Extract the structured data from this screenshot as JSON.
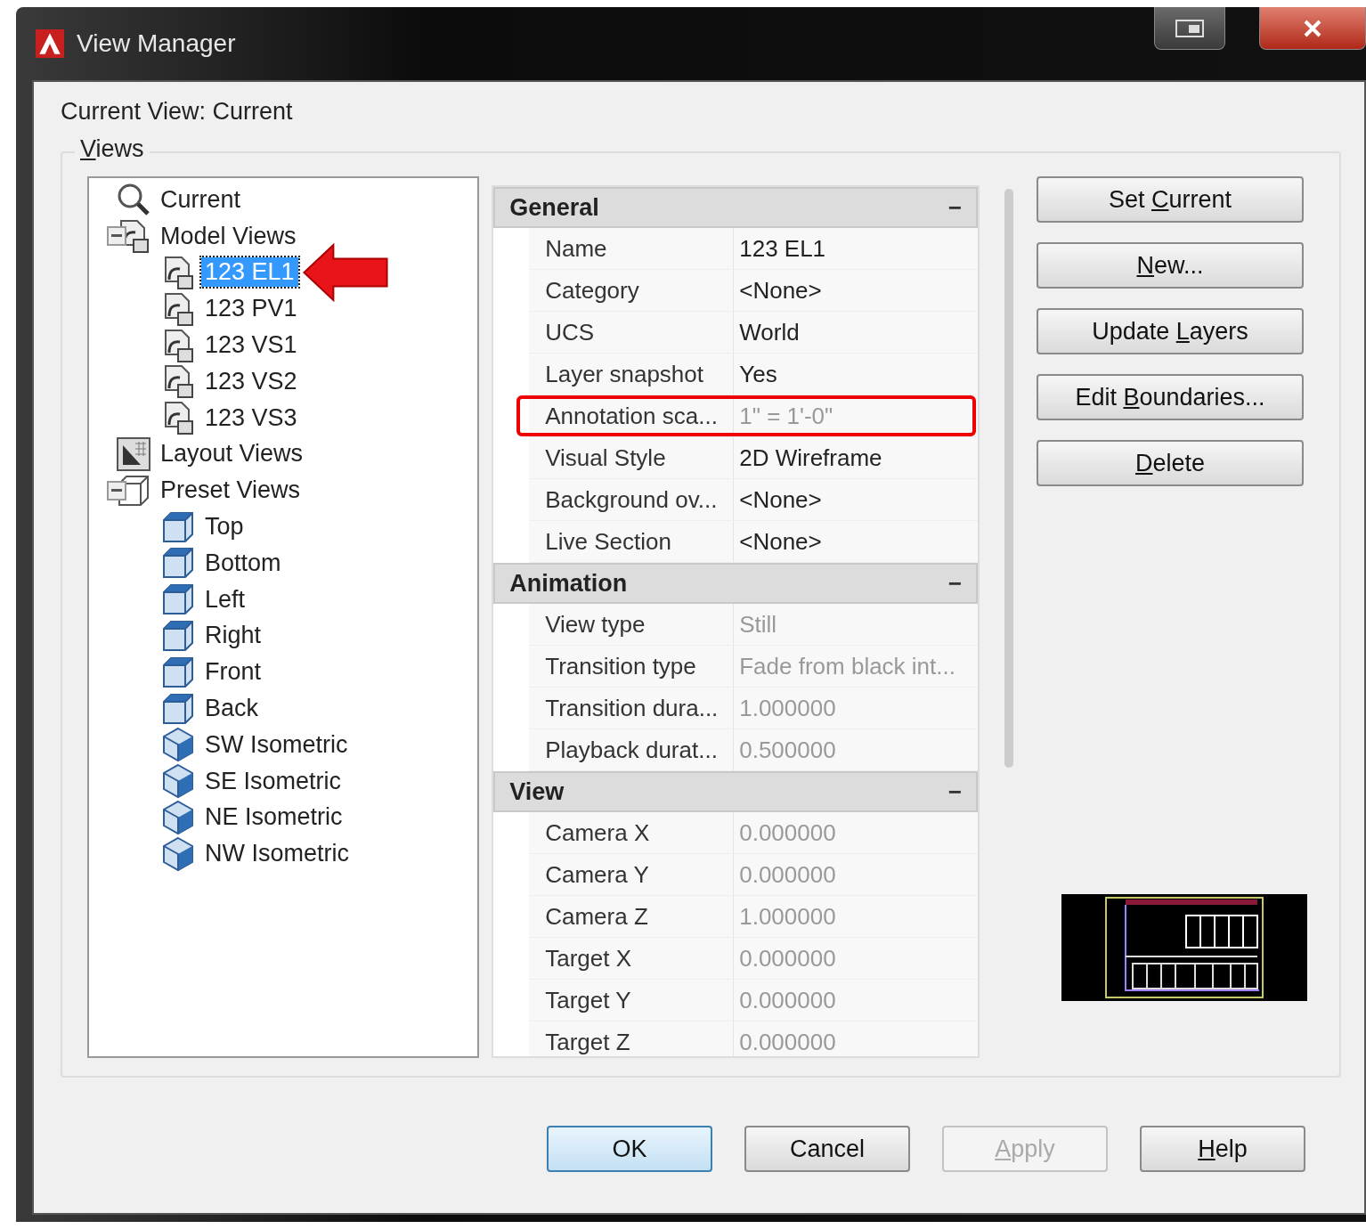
{
  "window": {
    "title": "View Manager"
  },
  "current_view": "Current View: Current",
  "views_group": {
    "label": [
      {
        "text": "V",
        "underlined": true
      },
      {
        "text": "iews",
        "underlined": false
      }
    ]
  },
  "tree": [
    {
      "label": "Current",
      "kind": "magnifier",
      "selected": false
    },
    {
      "label": "Model Views",
      "kind": "view",
      "selected": false,
      "expanded": true,
      "children": [
        {
          "label": "123 EL1",
          "kind": "view",
          "selected": true,
          "pointed": true
        },
        {
          "label": "123 PV1",
          "kind": "view",
          "selected": false
        },
        {
          "label": "123 VS1",
          "kind": "view",
          "selected": false
        },
        {
          "label": "123 VS2",
          "kind": "view",
          "selected": false
        },
        {
          "label": "123 VS3",
          "kind": "view",
          "selected": false
        }
      ]
    },
    {
      "label": "Layout Views",
      "kind": "layout",
      "selected": false
    },
    {
      "label": "Preset Views",
      "kind": "box",
      "selected": false,
      "expanded": true,
      "children": [
        {
          "label": "Top",
          "kind": "cube",
          "selected": false
        },
        {
          "label": "Bottom",
          "kind": "cube",
          "selected": false
        },
        {
          "label": "Left",
          "kind": "cube",
          "selected": false
        },
        {
          "label": "Right",
          "kind": "cube",
          "selected": false
        },
        {
          "label": "Front",
          "kind": "cube",
          "selected": false
        },
        {
          "label": "Back",
          "kind": "cube",
          "selected": false
        },
        {
          "label": "SW Isometric",
          "kind": "iso",
          "selected": false
        },
        {
          "label": "SE Isometric",
          "kind": "iso",
          "selected": false
        },
        {
          "label": "NE Isometric",
          "kind": "iso",
          "selected": false
        },
        {
          "label": "NW Isometric",
          "kind": "iso",
          "selected": false
        }
      ]
    }
  ],
  "sections": [
    {
      "title": "General",
      "toggle": "−",
      "rows": [
        {
          "name": "Name",
          "value": "123 EL1",
          "readonly": false,
          "highlighted": false
        },
        {
          "name": "Category",
          "value": "<None>",
          "readonly": false,
          "highlighted": false
        },
        {
          "name": "UCS",
          "value": "World",
          "readonly": false,
          "highlighted": false
        },
        {
          "name": "Layer snapshot",
          "value": "Yes",
          "readonly": false,
          "highlighted": false
        },
        {
          "name": "Annotation sca...",
          "value": "1\" = 1'-0\"",
          "readonly": true,
          "highlighted": true
        },
        {
          "name": "Visual Style",
          "value": "2D Wireframe",
          "readonly": false,
          "highlighted": false
        },
        {
          "name": "Background ov...",
          "value": "<None>",
          "readonly": false,
          "highlighted": false
        },
        {
          "name": "Live Section",
          "value": "<None>",
          "readonly": false,
          "highlighted": false
        }
      ]
    },
    {
      "title": "Animation",
      "toggle": "−",
      "rows": [
        {
          "name": "View type",
          "value": "Still",
          "readonly": true,
          "highlighted": false
        },
        {
          "name": "Transition type",
          "value": "Fade from black int...",
          "readonly": true,
          "highlighted": false
        },
        {
          "name": "Transition dura...",
          "value": "1.000000",
          "readonly": true,
          "highlighted": false
        },
        {
          "name": "Playback durat...",
          "value": "0.500000",
          "readonly": true,
          "highlighted": false
        }
      ]
    },
    {
      "title": "View",
      "toggle": "−",
      "rows": [
        {
          "name": "Camera X",
          "value": "0.000000",
          "readonly": true,
          "highlighted": false
        },
        {
          "name": "Camera Y",
          "value": "0.000000",
          "readonly": true,
          "highlighted": false
        },
        {
          "name": "Camera Z",
          "value": "1.000000",
          "readonly": true,
          "highlighted": false
        },
        {
          "name": "Target X",
          "value": "0.000000",
          "readonly": true,
          "highlighted": false
        },
        {
          "name": "Target Y",
          "value": "0.000000",
          "readonly": true,
          "highlighted": false
        },
        {
          "name": "Target Z",
          "value": "0.000000",
          "readonly": true,
          "highlighted": false
        }
      ]
    }
  ],
  "side_buttons": [
    {
      "label": [
        {
          "text": "Set ",
          "underlined": false
        },
        {
          "text": "C",
          "underlined": true
        },
        {
          "text": "urrent",
          "underlined": false
        }
      ],
      "disabled": false
    },
    {
      "label": [
        {
          "text": "N",
          "underlined": true
        },
        {
          "text": "ew...",
          "underlined": false
        }
      ],
      "disabled": false
    },
    {
      "label": [
        {
          "text": "Update ",
          "underlined": false
        },
        {
          "text": "L",
          "underlined": true
        },
        {
          "text": "ayers",
          "underlined": false
        }
      ],
      "disabled": false
    },
    {
      "label": [
        {
          "text": "Edit ",
          "underlined": false
        },
        {
          "text": "B",
          "underlined": true
        },
        {
          "text": "oundaries...",
          "underlined": false
        }
      ],
      "disabled": false
    },
    {
      "label": [
        {
          "text": "D",
          "underlined": true
        },
        {
          "text": "elete",
          "underlined": false
        }
      ],
      "disabled": false
    }
  ],
  "footer_buttons": [
    {
      "label": [
        {
          "text": "OK",
          "underlined": false
        }
      ],
      "disabled": false,
      "default": true
    },
    {
      "label": [
        {
          "text": "Cancel",
          "underlined": false
        }
      ],
      "disabled": false,
      "default": false
    },
    {
      "label": [
        {
          "text": "A",
          "underlined": true
        },
        {
          "text": "pply",
          "underlined": false
        }
      ],
      "disabled": true,
      "default": false
    },
    {
      "label": [
        {
          "text": "H",
          "underlined": true
        },
        {
          "text": "elp",
          "underlined": false
        }
      ],
      "disabled": false,
      "default": false
    }
  ]
}
